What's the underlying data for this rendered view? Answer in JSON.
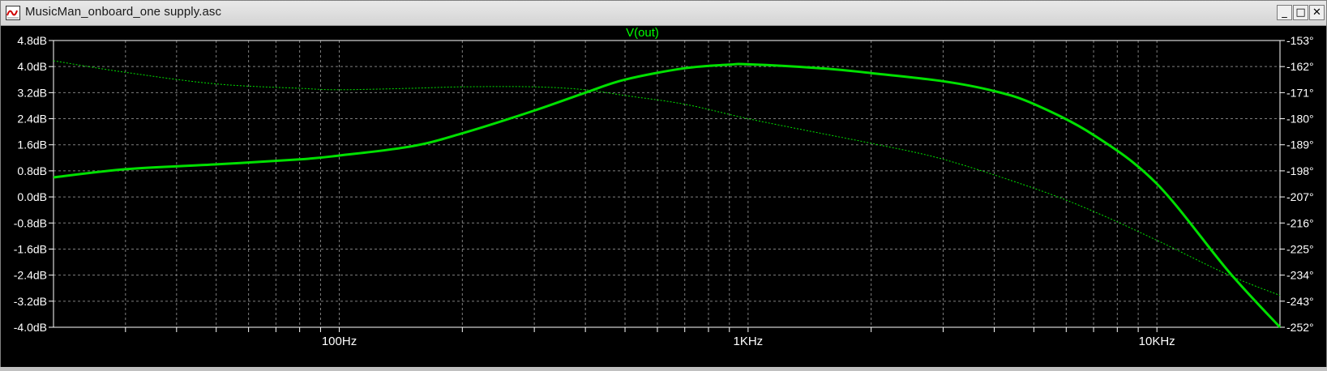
{
  "window": {
    "title": "MusicMan_onboard_one supply.asc",
    "buttons": {
      "minimize": "_",
      "maximize": "□",
      "close": "✕"
    },
    "icon": "waveform-icon"
  },
  "colors": {
    "background": "#000000",
    "grid": "#7f7f7f",
    "trace": "#00e000",
    "text": "#ffffff",
    "trace_label": "#00ff00"
  },
  "chart_data": {
    "type": "line",
    "title": "V(out)",
    "x_scale": "log",
    "xlim": [
      20,
      20000
    ],
    "x_tick_labels": [
      {
        "x": 100,
        "label": "100Hz"
      },
      {
        "x": 1000,
        "label": "1KHz"
      },
      {
        "x": 10000,
        "label": "10KHz"
      }
    ],
    "ylim_left": [
      -4.0,
      4.8
    ],
    "y_left_ticks": [
      "4.8dB",
      "4.0dB",
      "3.2dB",
      "2.4dB",
      "1.6dB",
      "0.8dB",
      "0.0dB",
      "-0.8dB",
      "-1.6dB",
      "-2.4dB",
      "-3.2dB",
      "-4.0dB"
    ],
    "ylim_right": [
      -252,
      -153
    ],
    "y_right_ticks": [
      "-153°",
      "-162°",
      "-171°",
      "-180°",
      "-189°",
      "-198°",
      "-207°",
      "-216°",
      "-225°",
      "-234°",
      "-243°",
      "-252°"
    ],
    "grid": true,
    "series": [
      {
        "name": "V(out)",
        "kind": "magnitude",
        "axis": "left",
        "style": "solid",
        "x": [
          20,
          30,
          50,
          80,
          100,
          150,
          200,
          300,
          400,
          500,
          700,
          900,
          1000,
          1500,
          2000,
          3000,
          4000,
          5000,
          7000,
          10000,
          15000,
          20000
        ],
        "y": [
          0.6,
          0.85,
          1.0,
          1.15,
          1.27,
          1.55,
          1.95,
          2.65,
          3.2,
          3.6,
          3.95,
          4.06,
          4.07,
          3.95,
          3.8,
          3.55,
          3.25,
          2.85,
          1.9,
          0.4,
          -2.3,
          -4.0
        ]
      },
      {
        "kind": "phase",
        "axis": "right",
        "style": "dotted",
        "x": [
          20,
          30,
          50,
          80,
          100,
          150,
          200,
          300,
          400,
          500,
          700,
          1000,
          1500,
          2000,
          3000,
          5000,
          7000,
          10000,
          15000,
          20000
        ],
        "y": [
          -160,
          -164,
          -168,
          -169.5,
          -170,
          -169.5,
          -169,
          -169,
          -170,
          -172,
          -175,
          -180,
          -185,
          -188.5,
          -194,
          -204,
          -212,
          -222,
          -234,
          -241
        ]
      }
    ]
  }
}
